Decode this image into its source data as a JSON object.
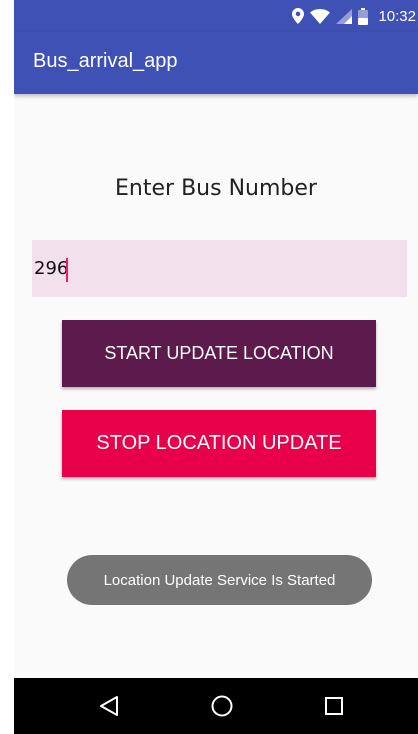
{
  "status_bar": {
    "time": "10:32",
    "icons": [
      "location-icon",
      "wifi-icon",
      "signal-icon",
      "battery-icon"
    ],
    "background": "#3f51b5"
  },
  "app_bar": {
    "title": "Bus_arrival_app",
    "background": "#3f51b5"
  },
  "main": {
    "heading": "Enter Bus Number",
    "bus_number_input": {
      "value": "296",
      "placeholder": ""
    },
    "start_button_label": "START UPDATE LOCATION",
    "stop_button_label": "STOP LOCATION UPDATE"
  },
  "toast": {
    "message": "Location Update Service Is Started"
  },
  "nav_bar": {
    "buttons": [
      "back-icon",
      "home-icon",
      "recents-icon"
    ]
  },
  "colors": {
    "primary": "#3f51b5",
    "start_button": "#5c1a4d",
    "stop_button": "#e8004a",
    "input_background": "#f2e0ec",
    "toast": "#757575",
    "caret": "#e91e63"
  }
}
